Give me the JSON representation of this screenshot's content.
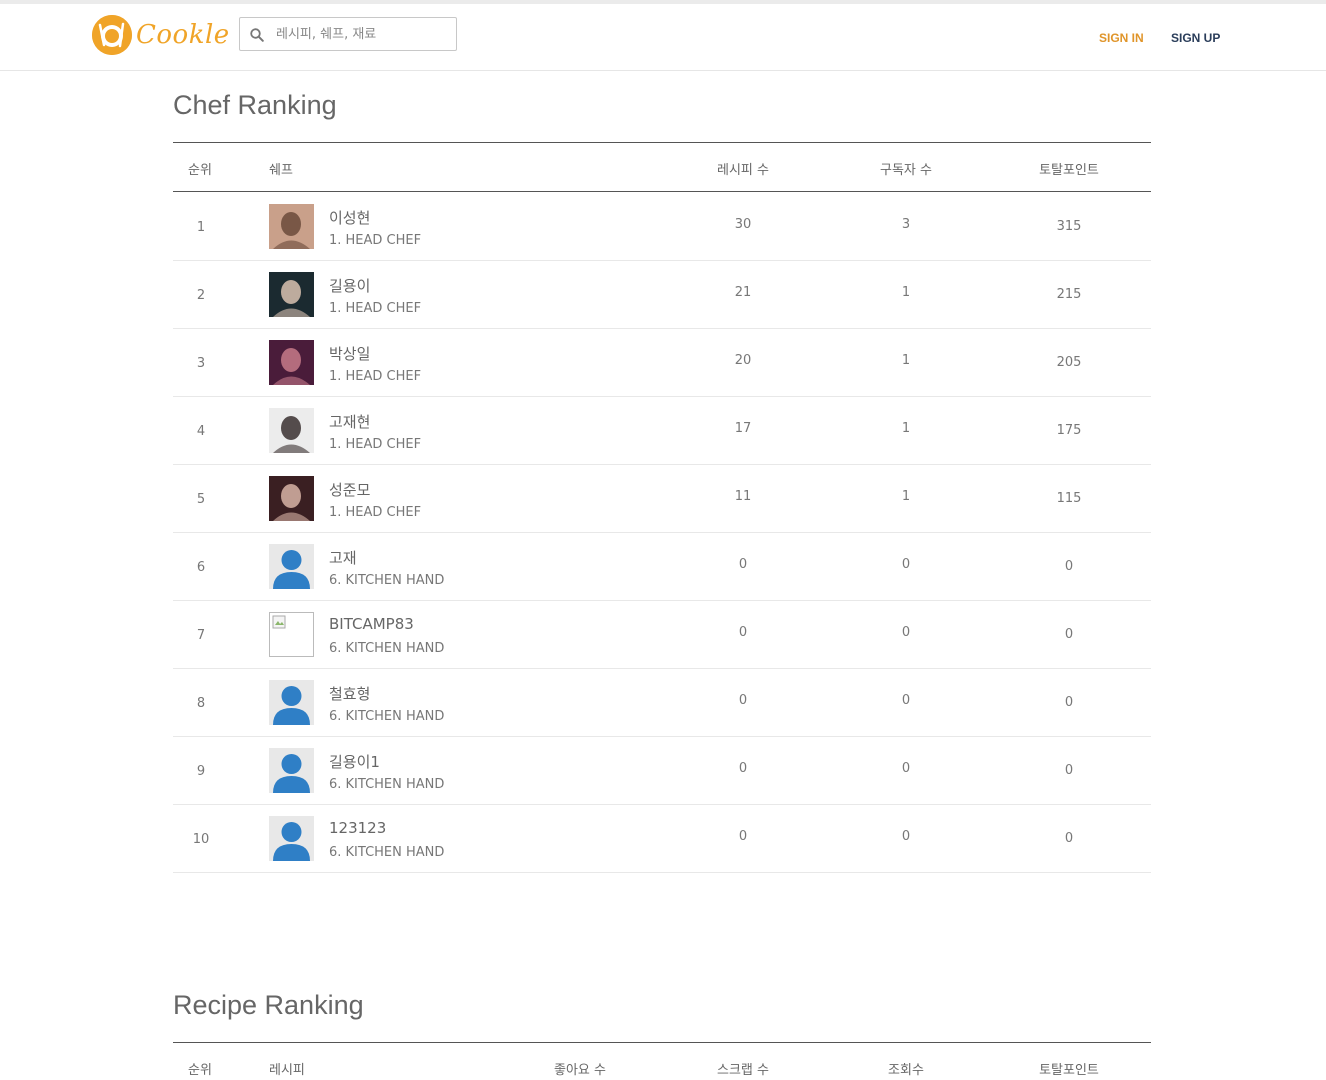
{
  "header": {
    "logo_text": "Cookle",
    "search_placeholder": "레시피, 쉐프, 재료",
    "sign_in": "SIGN IN",
    "sign_up": "SIGN UP"
  },
  "chef_ranking": {
    "title": "Chef Ranking",
    "columns": {
      "rank": "순위",
      "chef": "쉐프",
      "recipes": "레시피 수",
      "subscribers": "구독자 수",
      "points": "토탈포인트"
    },
    "rows": [
      {
        "rank": "1",
        "name": "이성현",
        "grade": "1. HEAD CHEF",
        "recipes": "30",
        "subscribers": "3",
        "points": "315",
        "avatar": "photo"
      },
      {
        "rank": "2",
        "name": "길용이",
        "grade": "1. HEAD CHEF",
        "recipes": "21",
        "subscribers": "1",
        "points": "215",
        "avatar": "photo"
      },
      {
        "rank": "3",
        "name": "박상일",
        "grade": "1. HEAD CHEF",
        "recipes": "20",
        "subscribers": "1",
        "points": "205",
        "avatar": "photo"
      },
      {
        "rank": "4",
        "name": "고재현",
        "grade": "1. HEAD CHEF",
        "recipes": "17",
        "subscribers": "1",
        "points": "175",
        "avatar": "photo"
      },
      {
        "rank": "5",
        "name": "성준모",
        "grade": "1. HEAD CHEF",
        "recipes": "11",
        "subscribers": "1",
        "points": "115",
        "avatar": "photo"
      },
      {
        "rank": "6",
        "name": "고재",
        "grade": "6. KITCHEN HAND",
        "recipes": "0",
        "subscribers": "0",
        "points": "0",
        "avatar": "default"
      },
      {
        "rank": "7",
        "name": "BITCAMP83",
        "grade": "6. KITCHEN HAND",
        "recipes": "0",
        "subscribers": "0",
        "points": "0",
        "avatar": "broken"
      },
      {
        "rank": "8",
        "name": "철효형",
        "grade": "6. KITCHEN HAND",
        "recipes": "0",
        "subscribers": "0",
        "points": "0",
        "avatar": "default"
      },
      {
        "rank": "9",
        "name": "길용이1",
        "grade": "6. KITCHEN HAND",
        "recipes": "0",
        "subscribers": "0",
        "points": "0",
        "avatar": "default"
      },
      {
        "rank": "10",
        "name": "123123",
        "grade": "6. KITCHEN HAND",
        "recipes": "0",
        "subscribers": "0",
        "points": "0",
        "avatar": "default"
      }
    ]
  },
  "recipe_ranking": {
    "title": "Recipe Ranking",
    "columns": {
      "rank": "순위",
      "recipe": "레시피",
      "likes": "좋아요 수",
      "scraps": "스크랩 수",
      "views": "조회수",
      "points": "토탈포인트"
    }
  },
  "colors": {
    "accent": "#f0a428",
    "sign_up": "#2a3d5a",
    "default_avatar": "#2f7fc6"
  }
}
